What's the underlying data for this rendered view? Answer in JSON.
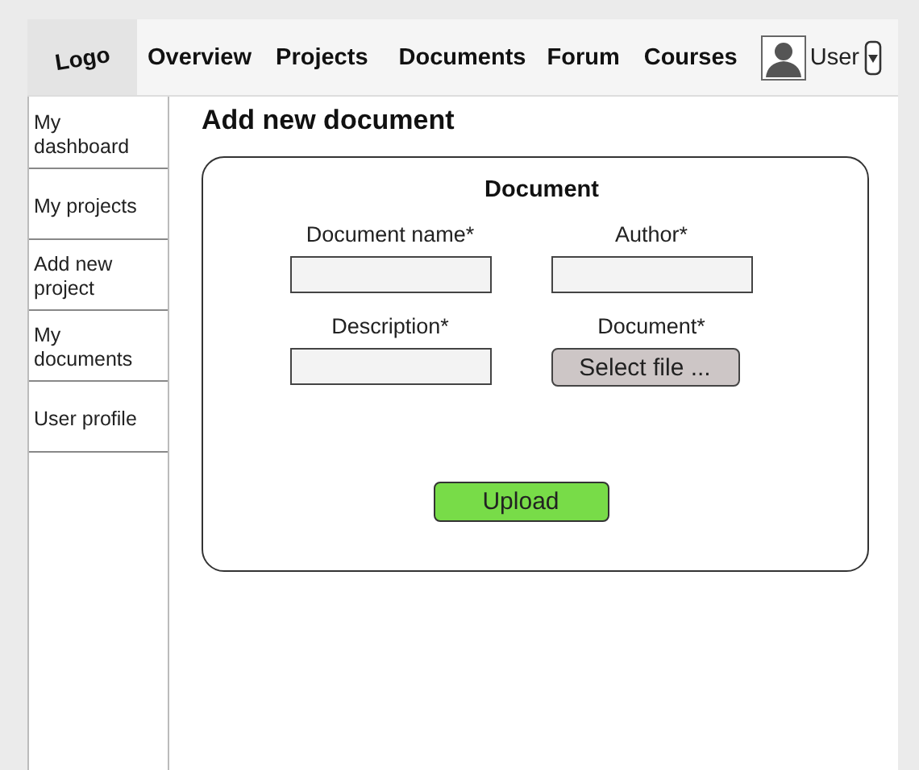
{
  "header": {
    "logo": "Logo",
    "nav": [
      {
        "label": "Overview"
      },
      {
        "label": "Projects"
      },
      {
        "label": "Documents"
      },
      {
        "label": "Forum"
      },
      {
        "label": "Courses"
      }
    ],
    "user": {
      "name": "User"
    }
  },
  "sidebar": {
    "items": [
      {
        "label": "My dashboard"
      },
      {
        "label": "My projects"
      },
      {
        "label": "Add new project"
      },
      {
        "label": "My documents"
      },
      {
        "label": "User profile"
      }
    ]
  },
  "page_title": "Add new document",
  "form": {
    "title": "Document",
    "fields": [
      {
        "kind": "text",
        "label": "Document name*"
      },
      {
        "kind": "text",
        "label": "Author*"
      },
      {
        "kind": "text",
        "label": "Description*"
      },
      {
        "kind": "file",
        "label": "Document*",
        "button": "Select file ..."
      }
    ],
    "submit": "Upload"
  }
}
